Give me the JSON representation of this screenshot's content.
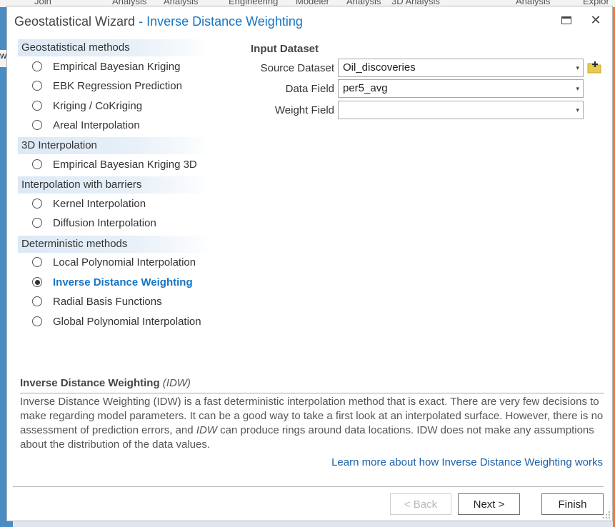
{
  "background": {
    "ribbon_items": [
      "Join",
      "Analysis",
      "Analysis",
      "Engineering",
      "Modeler",
      "Analysis",
      "3D Analysis",
      "Analysis",
      "Explor"
    ],
    "left_letter": "w"
  },
  "dialog": {
    "title": "Geostatistical Wizard",
    "subtitle": "- Inverse Distance Weighting",
    "maximize_icon": "maximize-icon",
    "close_icon": "close-icon",
    "close_glyph": "✕"
  },
  "methods": {
    "groups": [
      {
        "header": "Geostatistical methods",
        "items": [
          {
            "label": "Empirical Bayesian Kriging",
            "checked": false
          },
          {
            "label": "EBK Regression Prediction",
            "checked": false
          },
          {
            "label": "Kriging / CoKriging",
            "checked": false
          },
          {
            "label": "Areal Interpolation",
            "checked": false
          }
        ]
      },
      {
        "header": "3D Interpolation",
        "items": [
          {
            "label": "Empirical Bayesian Kriging 3D",
            "checked": false
          }
        ]
      },
      {
        "header": "Interpolation with barriers",
        "items": [
          {
            "label": "Kernel Interpolation",
            "checked": false
          },
          {
            "label": "Diffusion Interpolation",
            "checked": false
          }
        ]
      },
      {
        "header": "Deterministic methods",
        "items": [
          {
            "label": "Local Polynomial Interpolation",
            "checked": false
          },
          {
            "label": "Inverse Distance Weighting",
            "checked": true
          },
          {
            "label": "Radial Basis Functions",
            "checked": false
          },
          {
            "label": "Global Polynomial Interpolation",
            "checked": false
          }
        ]
      }
    ]
  },
  "input": {
    "section_title": "Input Dataset",
    "source_dataset": {
      "label": "Source Dataset",
      "value": "Oil_discoveries"
    },
    "data_field": {
      "label": "Data Field",
      "value": "per5_avg"
    },
    "weight_field": {
      "label": "Weight Field",
      "value": ""
    },
    "dropdown_glyph": "▾"
  },
  "description": {
    "title": "Inverse Distance Weighting",
    "title_abbr": "(IDW)",
    "body_1": "Inverse Distance Weighting (IDW) is a fast deterministic interpolation method that is exact. There are very few decisions to make regarding model parameters. It can be a good way to take a first look at an interpolated surface. However, there is no assessment of prediction errors, and ",
    "body_ital": "IDW",
    "body_2": " can produce rings around data locations. IDW does not make any assumptions about the distribution of the data values.",
    "learn_more": "Learn more about how Inverse Distance Weighting works"
  },
  "footer": {
    "back_label": "< Back",
    "next_label": "Next >",
    "finish_label": "Finish"
  },
  "colors": {
    "accent": "#1574c4",
    "link": "#1a5fa8",
    "group_header_bg": "#dce9f5"
  }
}
